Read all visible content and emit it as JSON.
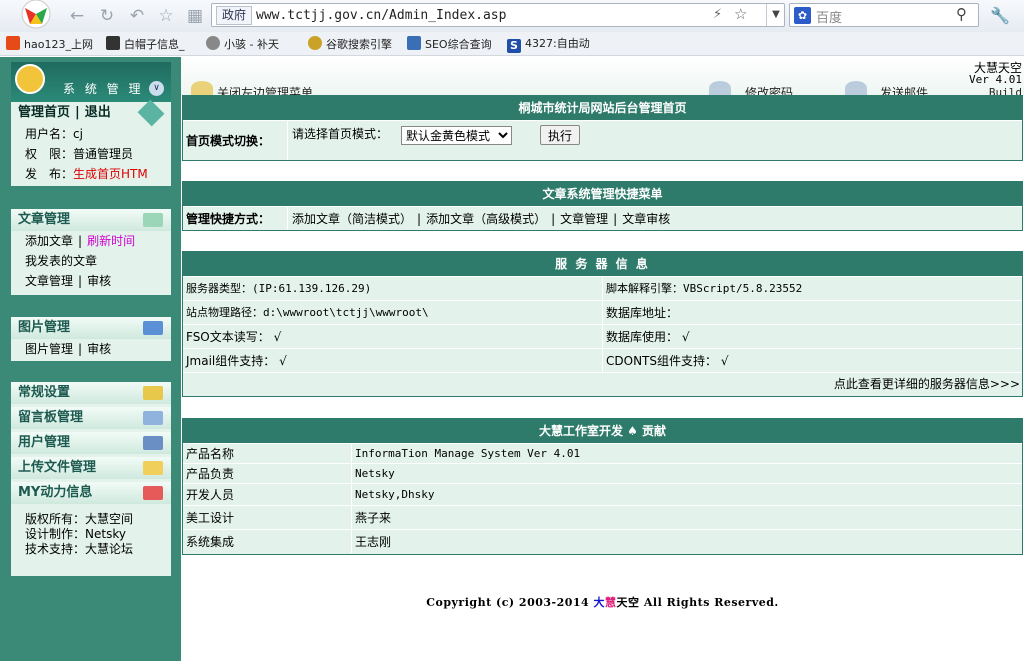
{
  "browser": {
    "url_tag": "政府",
    "url": "www.tctjj.gov.cn/Admin_Index.asp",
    "search_placeholder": "百度",
    "bookmarks": [
      "hao123_上网",
      "白帽子信息_",
      "小骇 - 补天",
      "谷歌搜索引擎",
      "SEO综合查询",
      "4327:自由动"
    ]
  },
  "sidebar": {
    "title": "系 统 管 理",
    "home_link": "管理首页",
    "logout_link": "退出",
    "user_label": "用户名：",
    "user_value": "cj",
    "perm_label": "权　限：",
    "perm_value": "普通管理员",
    "publish_label": "发　布：",
    "publish_value": "生成首页HTM",
    "article_title": "文章管理",
    "article_add": "添加文章",
    "article_refresh": "刷新时间",
    "article_mine": "我发表的文章",
    "article_manage": "文章管理",
    "article_audit": "审核",
    "image_title": "图片管理",
    "image_manage": "图片管理",
    "image_audit": "审核",
    "menu": [
      "常规设置",
      "留言板管理",
      "用户管理",
      "上传文件管理",
      "MY动力信息"
    ],
    "copyright_label": "版权所有：",
    "copyright_value": "大慧空间",
    "design_label": "设计制作：",
    "design_value": "Netsky",
    "support_label": "技术支持：",
    "support_value": "大慧论坛"
  },
  "topnav": {
    "close_menu": "关闭左边管理菜单",
    "change_pwd": "修改密码",
    "send_mail": "发送邮件",
    "brand_title": "大慧天空",
    "brand_version": "Ver 4.01",
    "build": "Build"
  },
  "home_mode": {
    "title": "桐城市统计局网站后台管理首页",
    "label": "首页模式切换：",
    "prompt": "请选择首页模式：",
    "selected": "默认金黄色模式",
    "exec": "执行"
  },
  "shortcut": {
    "title": "文章系统管理快捷菜单",
    "label": "管理快捷方式：",
    "links": [
      "添加文章（简洁模式）",
      "添加文章（高级模式）",
      "文章管理",
      "文章审核"
    ]
  },
  "server": {
    "title": "服 务 器 信 息",
    "type": "服务器类型：(IP:61.139.126.29)",
    "engine": "脚本解释引擎：VBScript/5.8.23552",
    "path": "站点物理路径：d:\\wwwroot\\tctjj\\wwwroot\\",
    "db_addr": "数据库地址：",
    "fso": "FSO文本读写：",
    "fso_val": "√",
    "db_use": "数据库使用：",
    "db_use_val": "√",
    "jmail": "Jmail组件支持：",
    "jmail_val": "√",
    "cdonts": "CDONTS组件支持：",
    "cdonts_val": "√",
    "more": "点此查看更详细的服务器信息>>>"
  },
  "credits": {
    "title": "大慧工作室开发 ♠ 贡献",
    "rows": [
      {
        "k": "产品名称",
        "v": "InformaTion Manage System Ver 4.01"
      },
      {
        "k": "产品负责",
        "v": "Netsky"
      },
      {
        "k": "开发人员",
        "v": "Netsky,Dhsky"
      },
      {
        "k": "美工设计",
        "v": "燕子来"
      },
      {
        "k": "系统集成",
        "v": "王志刚"
      }
    ]
  },
  "footer": {
    "prefix": "Copyright (c) 2003-2014 ",
    "brand1": "大",
    "brand2": "慧",
    "brand3": "天空",
    "suffix": " All Rights Reserved."
  },
  "colors": {
    "sidebar_bg": "#3b8a78",
    "header_bg": "#2f7b6b",
    "panel_bg": "#e3f3ec"
  }
}
